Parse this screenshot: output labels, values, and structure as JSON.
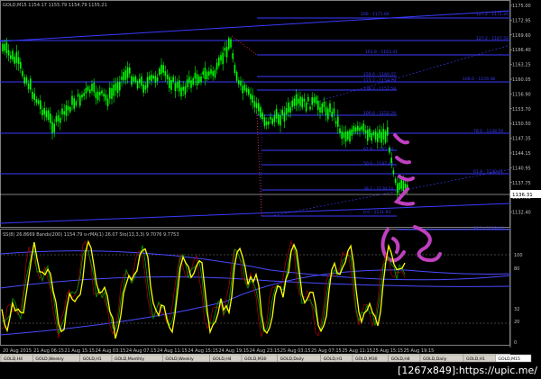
{
  "window": {
    "header_text": "GOLD,M15  1154.17 1155.79 1154.79 1155.21"
  },
  "price_axis": {
    "labels": [
      "1175.00",
      "1172.95",
      "1169.60",
      "1166.40",
      "1163.25",
      "1160.05",
      "1156.90",
      "1153.70",
      "1150.50",
      "1147.35",
      "1144.15",
      "1140.95",
      "1137.75",
      "1134.90",
      "1132.40"
    ],
    "current_price": "1136.31"
  },
  "fibo_labels": [
    {
      "text": "200 - 1171.64",
      "color": "#3a3aff"
    },
    {
      "text": "127.2 - 1171.20",
      "color": "#3a3aff"
    },
    {
      "text": "127.2 - 1167.50",
      "color": "#3a3aff"
    },
    {
      "text": "161.8 - 1163.41",
      "color": "#3a3aff"
    },
    {
      "text": "150.0 - 1160.47",
      "color": "#3a3aff"
    },
    {
      "text": "100.0 - 1159.38",
      "color": "#3a3aff"
    },
    {
      "text": "127.2 - 1158.79",
      "color": "#3a3aff"
    },
    {
      "text": "138.2 - 1157.58",
      "color": "#3a3aff"
    },
    {
      "text": "100.0 - 1152.24",
      "color": "#3a3aff"
    },
    {
      "text": "78.6 - 1148.59",
      "color": "#3a3aff"
    },
    {
      "text": "61.8 - 1145.04",
      "color": "#3a3aff"
    },
    {
      "text": "50.0 - 1142.44",
      "color": "#3a3aff"
    },
    {
      "text": "61.8 - 1140.21",
      "color": "#3a3aff"
    },
    {
      "text": "38.2 - 1138.74",
      "color": "#3a3aff"
    },
    {
      "text": "0.0 - 1131.93",
      "color": "#3a3aff"
    },
    {
      "text": "38.2 - 1129.06",
      "color": "#3a3aff"
    }
  ],
  "indicator": {
    "header_text": "SS(8) 26.8669  Bands(200) 1154.79  o-rMA(1) 26.07  Sto(13,3,3) 9.7076 9.7753",
    "axis_labels": [
      "100",
      "80",
      "32",
      "20",
      "0"
    ]
  },
  "time_axis": {
    "labels": [
      "20 Aug 2015",
      "21 Aug 06:15",
      "21 Aug 15:15",
      "24 Aug 03:15",
      "24 Aug 07:15",
      "24 Aug 11:15",
      "24 Aug 15:15",
      "24 Aug 19:15",
      "24 Aug 23:15",
      "25 Aug 03:15",
      "25 Aug 07:15",
      "25 Aug 11:15",
      "25 Aug 15:15",
      "25 Aug 19:15"
    ]
  },
  "tabs": [
    {
      "label": "GOLD,H4"
    },
    {
      "label": "GOLD,Weekly"
    },
    {
      "label": "GOLD,H1"
    },
    {
      "label": "GOLD,Monthly"
    },
    {
      "label": "GOLD,Weekly"
    },
    {
      "label": "GOLD,H4"
    },
    {
      "label": "GOLD,M30"
    },
    {
      "label": "GOLD,Daily"
    },
    {
      "label": "GOLD,H1"
    },
    {
      "label": "GOLD,M30"
    },
    {
      "label": "GOLD,H4"
    },
    {
      "label": "GOLD,Daily"
    },
    {
      "label": "GOLD,H1"
    },
    {
      "label": "GOLD,M15"
    }
  ],
  "active_tab": "GOLD,M15",
  "watermark": "[1267x849]:https://upic.me/",
  "colors": {
    "background": "#000000",
    "candle": "#00ff00",
    "fibo": "#3a3aff",
    "ss_line": "#ffff00",
    "bands": "#4a4aff",
    "annotation": "#c040c0",
    "axis_text": "#c0c0c0"
  }
}
